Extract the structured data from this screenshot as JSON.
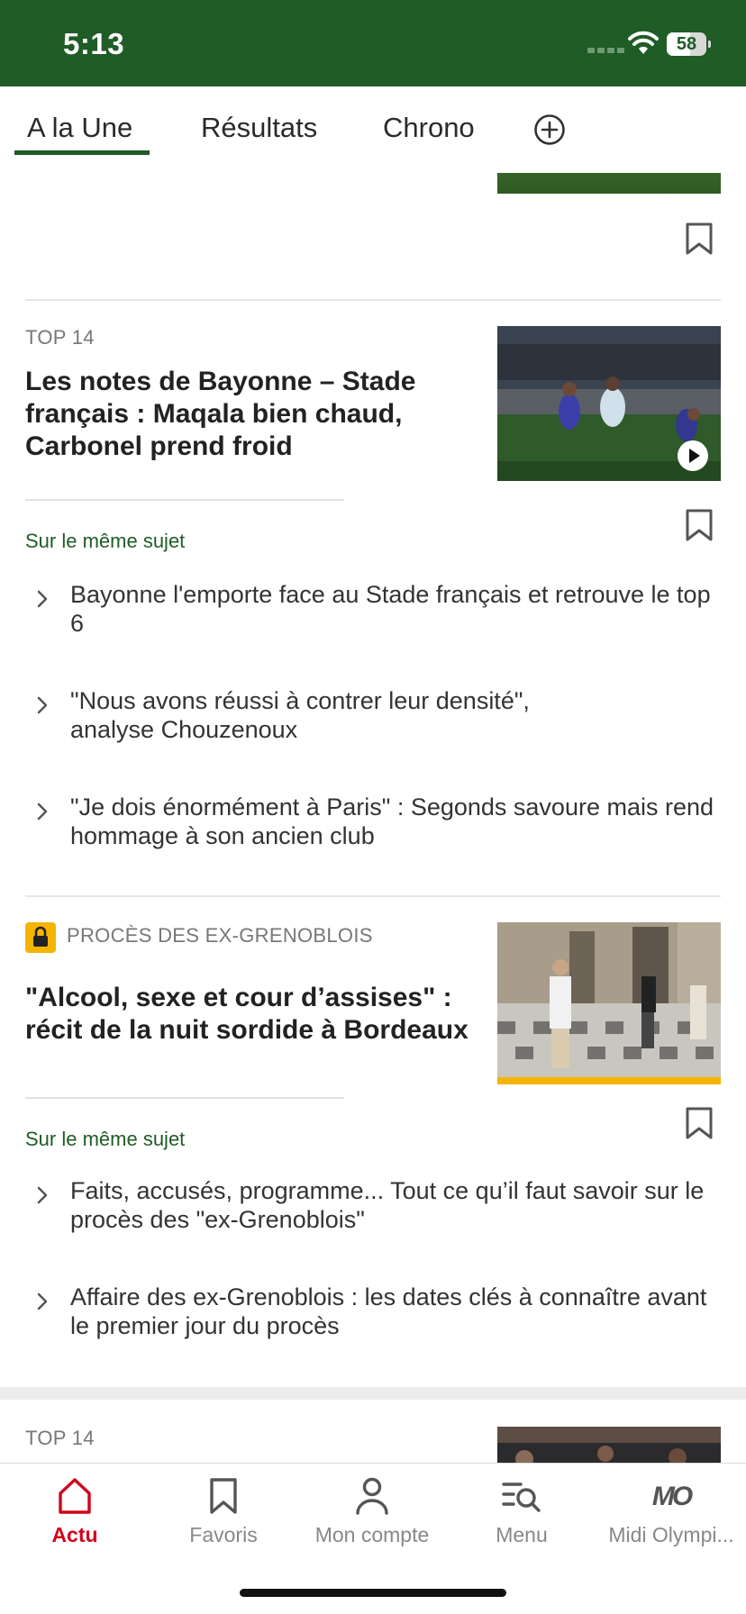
{
  "status": {
    "time": "5:13",
    "battery": "58",
    "battery_level": 0.58
  },
  "tabs": [
    {
      "label": "A la Une",
      "active": true
    },
    {
      "label": "Résultats",
      "active": false
    },
    {
      "label": "Chrono",
      "active": false
    }
  ],
  "articles": [
    {
      "kicker": "TOP 14",
      "headline": "Les notes de Bayonne – Stade français : Maqala bien chaud, Carbonel prend froid",
      "has_video": true,
      "related_label": "Sur le même sujet",
      "related": [
        "Bayonne l'emporte face au Stade français et retrouve le top 6",
        "\"Nous avons réussi à contrer leur densité\", analyse Chouzenoux",
        "\"Je dois énormément à Paris\" : Segonds savoure mais rend hommage à son ancien club"
      ]
    },
    {
      "kicker": "PROCÈS DES EX-GRENOBLOIS",
      "premium": true,
      "headline": "\"Alcool, sexe et cour d’assises\" : récit de la nuit sordide à Bordeaux",
      "related_label": "Sur le même sujet",
      "related": [
        "Faits, accusés, programme... Tout ce qu’il faut savoir sur le procès des \"ex-Grenoblois\"",
        "Affaire des ex-Grenoblois : les dates clés à connaître avant le premier jour du procès"
      ]
    },
    {
      "kicker": "TOP 14"
    }
  ],
  "bottom_nav": [
    {
      "label": "Actu",
      "icon": "home-icon",
      "active": true
    },
    {
      "label": "Favoris",
      "icon": "bookmark-icon",
      "active": false
    },
    {
      "label": "Mon compte",
      "icon": "user-icon",
      "active": false
    },
    {
      "label": "Menu",
      "icon": "menu-search-icon",
      "active": false
    },
    {
      "label": "Midi Olympi...",
      "icon": "midi-olympique-logo",
      "logo_text": "MO",
      "active": false
    }
  ],
  "colors": {
    "brand_green": "#1f5c26",
    "active_red": "#d0021b",
    "premium_yellow": "#f4b400"
  }
}
